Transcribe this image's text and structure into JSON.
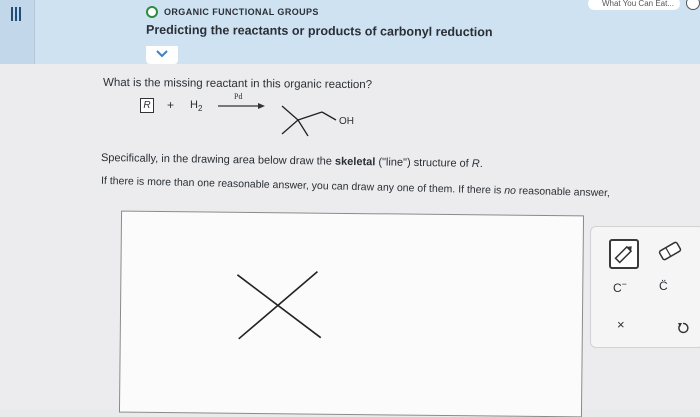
{
  "header": {
    "topic": "ORGANIC FUNCTIONAL GROUPS",
    "title": "Predicting the reactants or products of carbonyl reduction",
    "top_right_text": "What You Can Eat...",
    "collapse_icon": "chevron-down-icon"
  },
  "question": {
    "prompt": "What is the missing reactant in this organic reaction?"
  },
  "reaction": {
    "reactant_label": "R",
    "plus": "+",
    "reagent": "H",
    "reagent_subscript": "2",
    "catalyst": "Pd",
    "product_group": "OH"
  },
  "instructions": {
    "line1_pre": "Specifically, in the drawing area below draw the ",
    "line1_bold": "skeletal",
    "line1_post": " (\"line\") structure of ",
    "line1_var": "R",
    "line1_end": ".",
    "line2_pre": "If there is more than one reasonable answer, you can draw any one of them. If there is ",
    "line2_italic": "no",
    "line2_post": " reasonable answer,"
  },
  "tools": {
    "pencil": "pencil-icon",
    "eraser": "eraser-icon",
    "carbanion": "C",
    "carbanion_charge": "−",
    "carbon_lone_pair": "C̈",
    "clear": "×",
    "undo": "undo-icon"
  },
  "colors": {
    "header_bg": "#cfe2f1",
    "accent_green": "#2a8f3c",
    "accent_blue": "#3b82c4"
  }
}
